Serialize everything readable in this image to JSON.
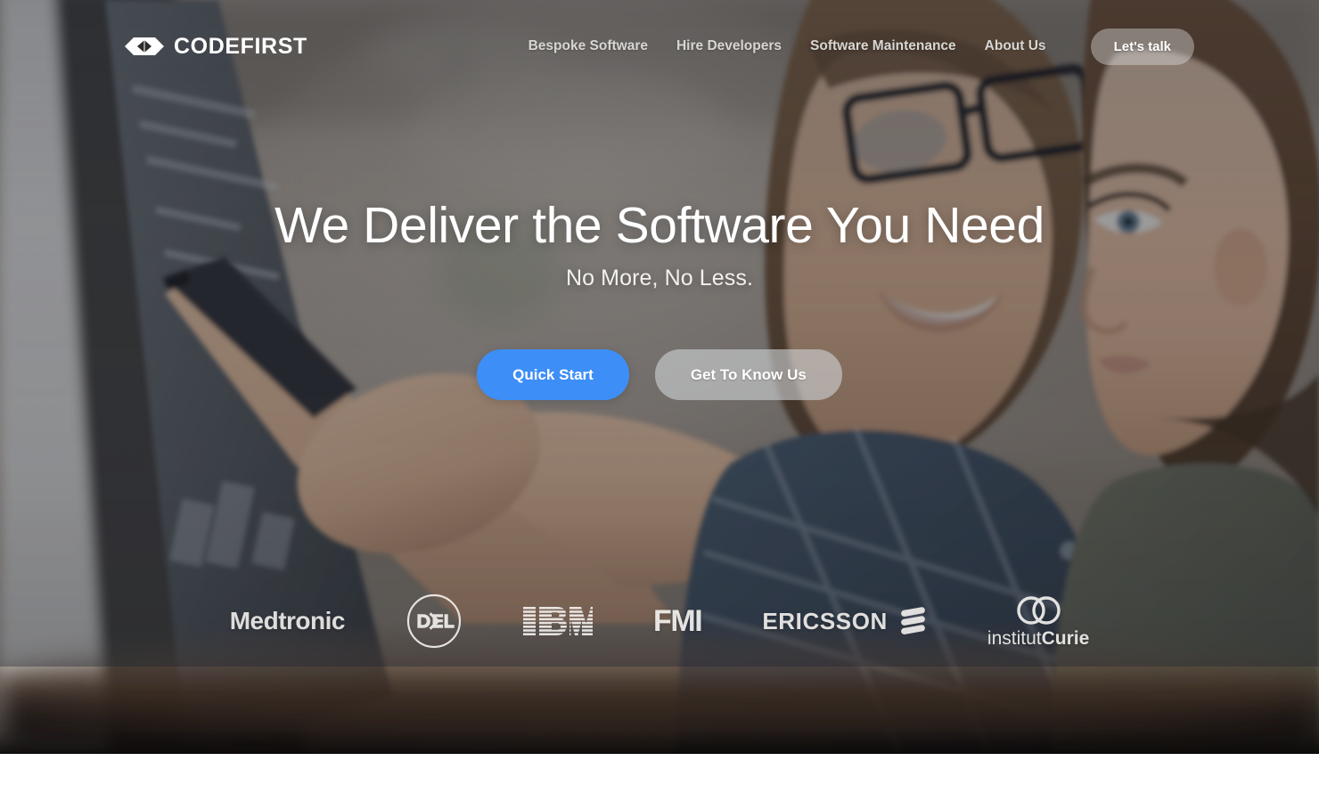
{
  "brand": {
    "name": "CODEFIRST",
    "mark_icon": "code-brackets-hexagon-logo"
  },
  "header": {
    "nav_items": [
      {
        "label": "Bespoke Software"
      },
      {
        "label": "Hire Developers"
      },
      {
        "label": "Software Maintenance"
      },
      {
        "label": "About Us"
      }
    ],
    "cta_label": "Let's talk"
  },
  "hero": {
    "title": "We Deliver the Software You Need",
    "subtitle": "No More, No Less.",
    "primary_button": "Quick Start",
    "secondary_button": "Get To Know Us",
    "background_description": "Two colleagues reviewing designs on a screen in an office"
  },
  "clients": [
    {
      "name": "Medtronic",
      "text": "Medtronic",
      "icon": "medtronic-wordmark"
    },
    {
      "name": "Dell",
      "text": "DØLL",
      "icon": "dell-circle-logo"
    },
    {
      "name": "IBM",
      "text": "IBM",
      "icon": "ibm-striped-logo"
    },
    {
      "name": "FMI",
      "text": "FMI",
      "icon": "fmi-wordmark"
    },
    {
      "name": "Ericsson",
      "text": "ERICSSON",
      "icon": "ericsson-three-bars-logo"
    },
    {
      "name": "Institut Curie",
      "text_thin": "institut",
      "text_bold": "Curie",
      "icon": "institut-curie-rings-logo"
    }
  ],
  "colors": {
    "primary_button": "#3d8ef7",
    "secondary_button": "rgba(205,208,212,0.62)",
    "hero_text": "#ffffff",
    "nav_text": "#d8d6d3",
    "page_background": "#ffffff"
  }
}
